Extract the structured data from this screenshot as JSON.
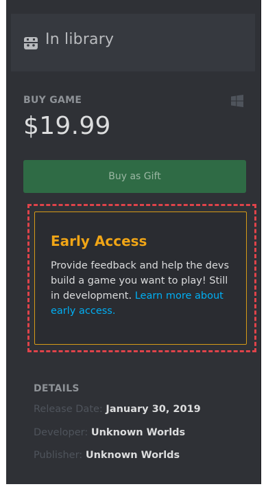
{
  "library": {
    "label": "In library",
    "icon": "game-controller-icon"
  },
  "purchase": {
    "buy_label": "BUY GAME",
    "price": "$19.99",
    "platform_icon": "windows-icon",
    "gift_button_label": "Buy as Gift"
  },
  "early_access": {
    "title": "Early Access",
    "description": "Provide feedback and help the devs build a game you want to play! Still in development.",
    "link_text": "Learn more about early access."
  },
  "details": {
    "heading": "DETAILS",
    "rows": [
      {
        "key": "Release Date:",
        "value": "January 30, 2019"
      },
      {
        "key": "Developer:",
        "value": "Unknown Worlds"
      },
      {
        "key": "Publisher:",
        "value": "Unknown Worlds"
      }
    ]
  },
  "colors": {
    "panel_bg": "#2f3136",
    "accent_green": "#2f6b45",
    "early_access_orange": "#f0a516",
    "link_blue": "#00aff4",
    "highlight_red": "#e0434a"
  }
}
